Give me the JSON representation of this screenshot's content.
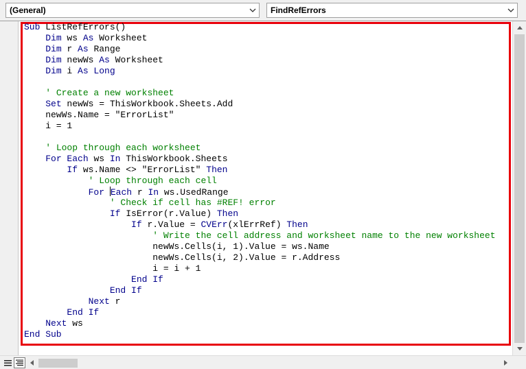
{
  "object_combo": {
    "value": "(General)"
  },
  "procedure_combo": {
    "value": "FindRefErrors"
  },
  "code_lines": [
    [
      {
        "t": "Sub",
        "k": "kw"
      },
      {
        "t": " ListRefErrors()",
        "k": ""
      }
    ],
    [
      {
        "t": "    ",
        "k": ""
      },
      {
        "t": "Dim",
        "k": "kw"
      },
      {
        "t": " ws ",
        "k": ""
      },
      {
        "t": "As",
        "k": "kw"
      },
      {
        "t": " Worksheet",
        "k": ""
      }
    ],
    [
      {
        "t": "    ",
        "k": ""
      },
      {
        "t": "Dim",
        "k": "kw"
      },
      {
        "t": " r ",
        "k": ""
      },
      {
        "t": "As",
        "k": "kw"
      },
      {
        "t": " Range",
        "k": ""
      }
    ],
    [
      {
        "t": "    ",
        "k": ""
      },
      {
        "t": "Dim",
        "k": "kw"
      },
      {
        "t": " newWs ",
        "k": ""
      },
      {
        "t": "As",
        "k": "kw"
      },
      {
        "t": " Worksheet",
        "k": ""
      }
    ],
    [
      {
        "t": "    ",
        "k": ""
      },
      {
        "t": "Dim",
        "k": "kw"
      },
      {
        "t": " i ",
        "k": ""
      },
      {
        "t": "As Long",
        "k": "kw"
      }
    ],
    [],
    [
      {
        "t": "    ",
        "k": ""
      },
      {
        "t": "' Create a new worksheet",
        "k": "cm"
      }
    ],
    [
      {
        "t": "    ",
        "k": ""
      },
      {
        "t": "Set",
        "k": "kw"
      },
      {
        "t": " newWs = ThisWorkbook.Sheets.Add",
        "k": ""
      }
    ],
    [
      {
        "t": "    newWs.Name = \"ErrorList\"",
        "k": ""
      }
    ],
    [
      {
        "t": "    i = 1",
        "k": ""
      }
    ],
    [],
    [
      {
        "t": "    ",
        "k": ""
      },
      {
        "t": "' Loop through each worksheet",
        "k": "cm"
      }
    ],
    [
      {
        "t": "    ",
        "k": ""
      },
      {
        "t": "For Each",
        "k": "kw"
      },
      {
        "t": " ws ",
        "k": ""
      },
      {
        "t": "In",
        "k": "kw"
      },
      {
        "t": " ThisWorkbook.Sheets",
        "k": ""
      }
    ],
    [
      {
        "t": "        ",
        "k": ""
      },
      {
        "t": "If",
        "k": "kw"
      },
      {
        "t": " ws.Name <> \"ErrorList\" ",
        "k": ""
      },
      {
        "t": "Then",
        "k": "kw"
      }
    ],
    [
      {
        "t": "            ",
        "k": ""
      },
      {
        "t": "' Loop through each cell",
        "k": "cm"
      }
    ],
    [
      {
        "t": "            ",
        "k": ""
      },
      {
        "t": "For ",
        "k": "kw"
      },
      {
        "t": "",
        "k": "caret"
      },
      {
        "t": "Each",
        "k": "kw"
      },
      {
        "t": " r ",
        "k": ""
      },
      {
        "t": "In",
        "k": "kw"
      },
      {
        "t": " ws.UsedRange",
        "k": ""
      }
    ],
    [
      {
        "t": "                ",
        "k": ""
      },
      {
        "t": "' Check if cell has #REF! error",
        "k": "cm"
      }
    ],
    [
      {
        "t": "                ",
        "k": ""
      },
      {
        "t": "If",
        "k": "kw"
      },
      {
        "t": " IsError(r.Value) ",
        "k": ""
      },
      {
        "t": "Then",
        "k": "kw"
      }
    ],
    [
      {
        "t": "                    ",
        "k": ""
      },
      {
        "t": "If",
        "k": "kw"
      },
      {
        "t": " r.Value = ",
        "k": ""
      },
      {
        "t": "CVErr",
        "k": "kw"
      },
      {
        "t": "(xlErrRef) ",
        "k": ""
      },
      {
        "t": "Then",
        "k": "kw"
      }
    ],
    [
      {
        "t": "                        ",
        "k": ""
      },
      {
        "t": "' Write the cell address and worksheet name to the new worksheet",
        "k": "cm"
      }
    ],
    [
      {
        "t": "                        newWs.Cells(i, 1).Value = ws.Name",
        "k": ""
      }
    ],
    [
      {
        "t": "                        newWs.Cells(i, 2).Value = r.Address",
        "k": ""
      }
    ],
    [
      {
        "t": "                        i = i + 1",
        "k": ""
      }
    ],
    [
      {
        "t": "                    ",
        "k": ""
      },
      {
        "t": "End If",
        "k": "kw"
      }
    ],
    [
      {
        "t": "                ",
        "k": ""
      },
      {
        "t": "End If",
        "k": "kw"
      }
    ],
    [
      {
        "t": "            ",
        "k": ""
      },
      {
        "t": "Next",
        "k": "kw"
      },
      {
        "t": " r",
        "k": ""
      }
    ],
    [
      {
        "t": "        ",
        "k": ""
      },
      {
        "t": "End If",
        "k": "kw"
      }
    ],
    [
      {
        "t": "    ",
        "k": ""
      },
      {
        "t": "Next",
        "k": "kw"
      },
      {
        "t": " ws",
        "k": ""
      }
    ],
    [
      {
        "t": "End Sub",
        "k": "kw"
      }
    ]
  ],
  "colors": {
    "keyword": "#00008b",
    "comment": "#008000",
    "highlight_border": "#e8000b"
  },
  "icons": {
    "dropdown": "chevron-down-icon",
    "procedure_view": "procedure-view-icon",
    "full_module_view": "full-module-view-icon",
    "scroll_up": "triangle-up-icon",
    "scroll_down": "triangle-down-icon",
    "scroll_left": "triangle-left-icon",
    "scroll_right": "triangle-right-icon"
  }
}
